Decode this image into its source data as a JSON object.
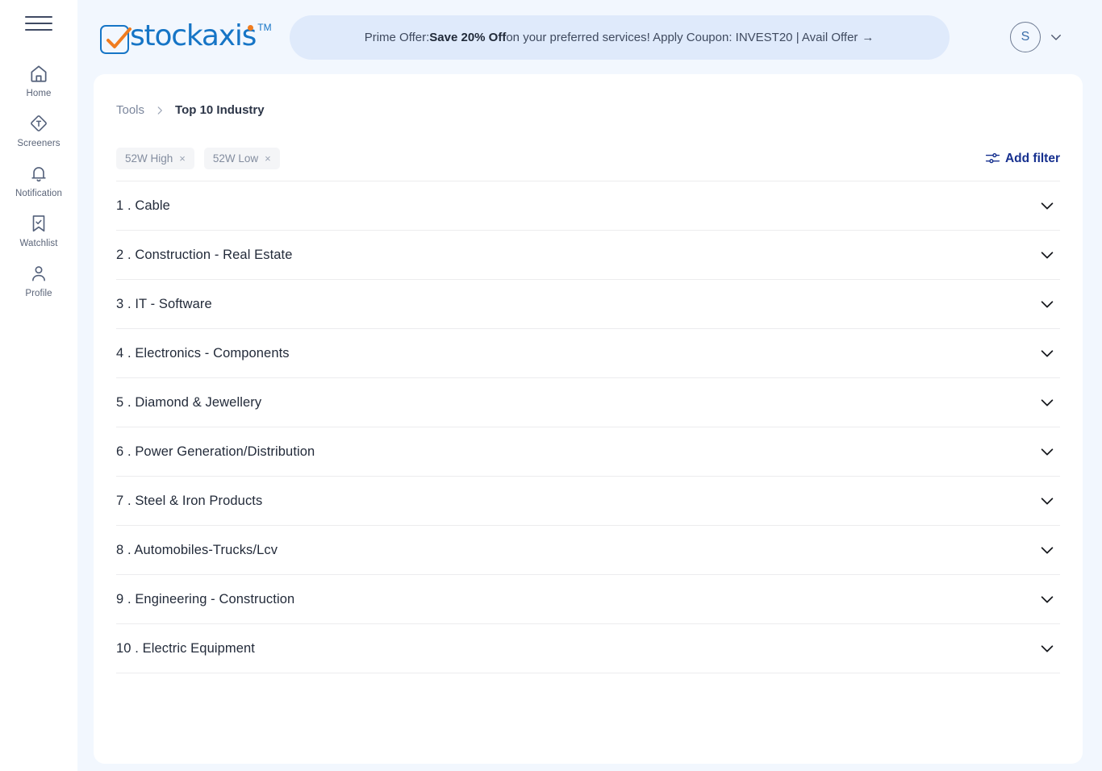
{
  "sidebar": {
    "menu_icon": "hamburger-icon",
    "items": [
      {
        "label": "Home",
        "icon": "home-icon"
      },
      {
        "label": "Screeners",
        "icon": "screeners-icon"
      },
      {
        "label": "Notification",
        "icon": "bell-icon"
      },
      {
        "label": "Watchlist",
        "icon": "bookmark-check-icon"
      },
      {
        "label": "Profile",
        "icon": "person-icon"
      }
    ]
  },
  "header": {
    "logo": {
      "word": "stockaxis",
      "trademark": "TM",
      "icon": "checkbox-check-icon"
    },
    "promo": {
      "prefix": "Prime Offer: ",
      "highlight": "Save 20% Off",
      "suffix": " on your preferred services! Apply Coupon: INVEST20 | Avail Offer",
      "arrow": "→"
    },
    "account": {
      "initial": "S",
      "chevron": "chevron-down-icon"
    }
  },
  "breadcrumb": {
    "root": "Tools",
    "separator": "chevron-right-icon",
    "current": "Top 10 Industry"
  },
  "filters": {
    "chips": [
      {
        "label": "52W High",
        "remove": "×"
      },
      {
        "label": "52W Low",
        "remove": "×"
      }
    ],
    "add_filter_label": "Add filter",
    "add_filter_icon": "sliders-icon"
  },
  "industries": [
    {
      "label": "1 . Cable"
    },
    {
      "label": "2 . Construction - Real Estate"
    },
    {
      "label": "3 . IT - Software"
    },
    {
      "label": "4 . Electronics - Components"
    },
    {
      "label": "5 . Diamond & Jewellery"
    },
    {
      "label": "6 . Power Generation/Distribution"
    },
    {
      "label": "7 . Steel & Iron Products"
    },
    {
      "label": "8 . Automobiles-Trucks/Lcv"
    },
    {
      "label": "9 . Engineering - Construction"
    },
    {
      "label": "10 . Electric Equipment"
    }
  ],
  "colors": {
    "page_background": "#f2f7fe",
    "card_background": "#ffffff",
    "promo_background": "#dfeafb",
    "brand_blue": "#1675c6",
    "brand_orange": "#f07c1f",
    "accent_navy": "#16308f",
    "divider": "#ececee"
  }
}
